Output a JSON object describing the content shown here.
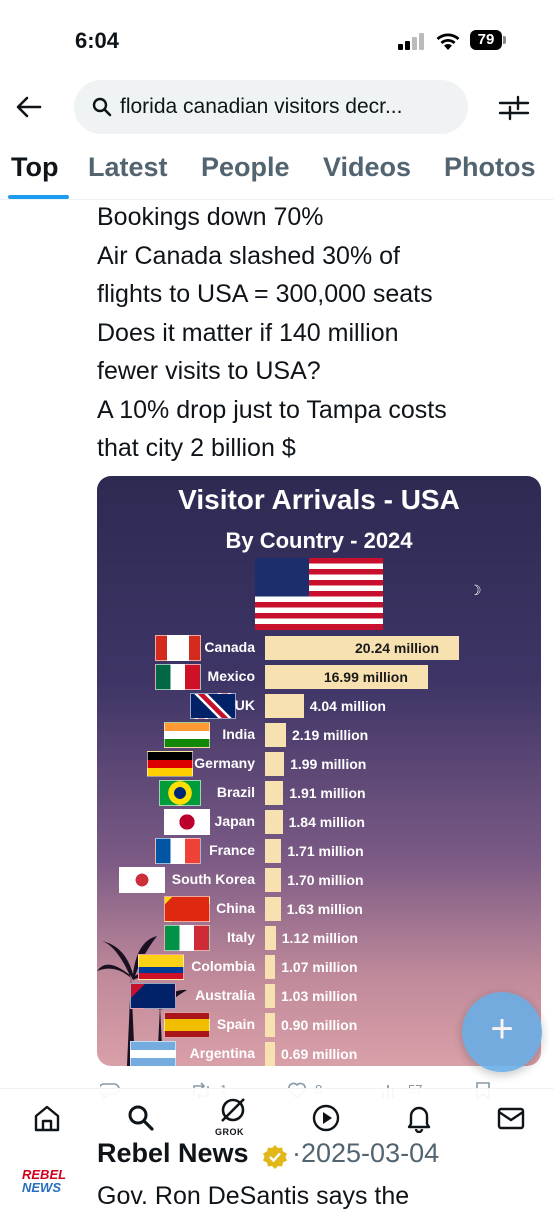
{
  "status_bar": {
    "time": "6:04",
    "battery": "79"
  },
  "search": {
    "query": "florida canadian visitors decr..."
  },
  "tabs": [
    {
      "label": "Top"
    },
    {
      "label": "Latest"
    },
    {
      "label": "People"
    },
    {
      "label": "Videos"
    },
    {
      "label": "Photos"
    }
  ],
  "active_tab": "Top",
  "tweet_text": [
    "Bookings down 70%",
    "Air Canada slashed 30% of",
    "flights to USA = 300,000 seats",
    "Does it matter if 140 million",
    "fewer visits to USA?",
    "A 10% drop just to Tampa costs",
    "that city 2 billion $"
  ],
  "card": {
    "title": "Visitor Arrivals - USA",
    "subtitle": "By Country - 2024"
  },
  "chart_data": {
    "type": "bar",
    "title": "Visitor Arrivals - USA",
    "subtitle": "By Country - 2024",
    "orientation": "horizontal",
    "unit": "million",
    "categories": [
      "Canada",
      "Mexico",
      "UK",
      "India",
      "Germany",
      "Brazil",
      "Japan",
      "France",
      "South Korea",
      "China",
      "Italy",
      "Colombia",
      "Australia",
      "Spain",
      "Argentina"
    ],
    "values": [
      20.24,
      16.99,
      4.04,
      2.19,
      1.99,
      1.91,
      1.84,
      1.71,
      1.7,
      1.63,
      1.12,
      1.07,
      1.03,
      0.9,
      0.69
    ],
    "labels": [
      "20.24 million",
      "16.99 million",
      "4.04 million",
      "2.19 million",
      "1.99 million",
      "1.91 million",
      "1.84 million",
      "1.71 million",
      "1.70 million",
      "1.63 million",
      "1.12 million",
      "1.07 million",
      "1.03 million",
      "0.90 million",
      "0.69 million"
    ],
    "bar_color": "#f7e1b0"
  },
  "actions": {
    "reply": "",
    "retweet": "1",
    "like": "8",
    "views": "57"
  },
  "bottom_nav": {
    "grok_label": "GROK"
  },
  "next_tweet": {
    "author": "Rebel News",
    "date": "·2025-03-04",
    "text": "Gov. Ron DeSantis says the",
    "logo_line1": "REBEL",
    "logo_line2": "NEWS"
  },
  "fab": {
    "label": "+"
  }
}
